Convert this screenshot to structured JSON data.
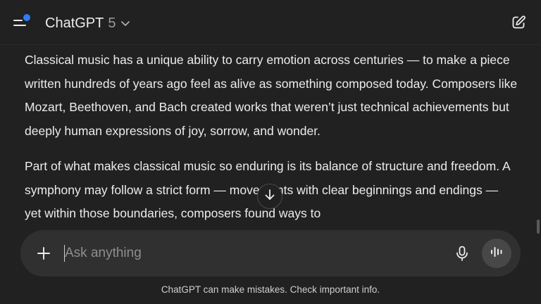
{
  "header": {
    "model_name": "ChatGPT",
    "model_version": "5",
    "icons": {
      "sidebar": "sidebar-toggle-icon",
      "chevron": "chevron-down-icon",
      "new_chat": "new-chat-icon"
    }
  },
  "message": {
    "paragraphs": [
      "Classical music has a unique ability to carry emotion across centuries — to make a piece written hundreds of years ago feel as alive as something composed today. Composers like Mozart, Beethoven, and Bach created works that weren’t just technical achievements but deeply human expressions of joy, sorrow, and wonder.",
      "Part of what makes classical music so enduring is its balance of structure and freedom. A symphony may follow a strict form — movements with clear beginnings and endings — yet within those boundaries, composers found ways to"
    ]
  },
  "composer": {
    "placeholder": "Ask anything",
    "value": "",
    "icons": {
      "add": "plus-icon",
      "dictate": "microphone-icon",
      "voice": "voice-mode-icon"
    }
  },
  "scroll_button": {
    "icon": "arrow-down-icon"
  },
  "footer": {
    "disclaimer": "ChatGPT can make mistakes. Check important info."
  },
  "colors": {
    "background": "#212121",
    "composer": "#303030",
    "accent_dot": "#2f7cf6",
    "text": "#ececec",
    "muted": "#9b9b9b"
  }
}
